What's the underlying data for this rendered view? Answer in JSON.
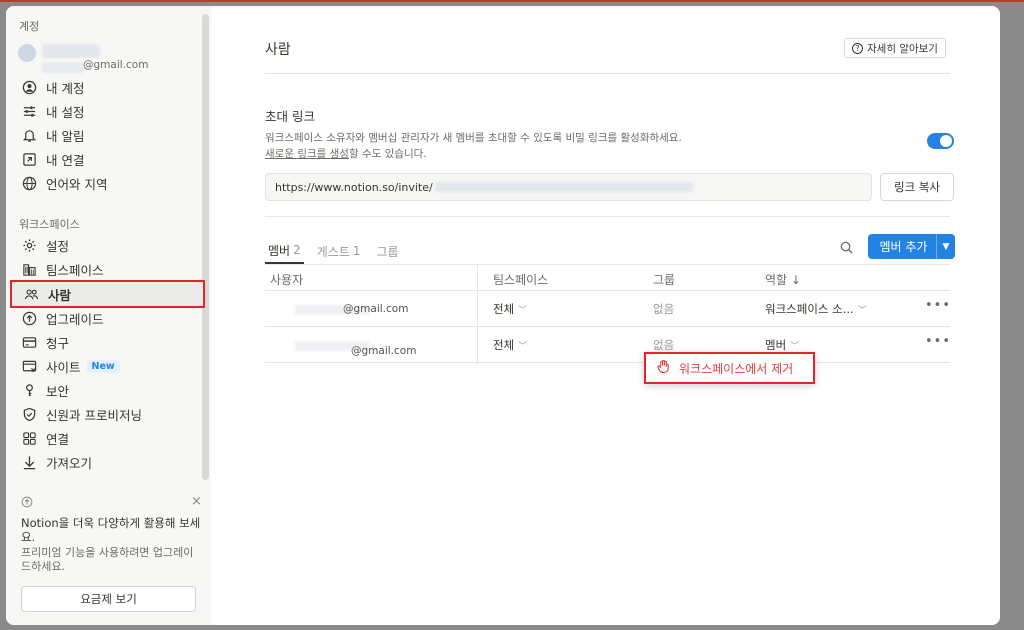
{
  "sidebar": {
    "account_heading": "계정",
    "user_email_suffix": "@gmail.com",
    "account_items": [
      {
        "label": "내 계정",
        "icon": "user-circle-icon"
      },
      {
        "label": "내 설정",
        "icon": "sliders-icon"
      },
      {
        "label": "내 알림",
        "icon": "bell-icon"
      },
      {
        "label": "내 연결",
        "icon": "external-link-icon"
      },
      {
        "label": "언어와 지역",
        "icon": "globe-icon"
      }
    ],
    "workspace_heading": "워크스페이스",
    "workspace_items": [
      {
        "label": "설정",
        "icon": "gear-icon"
      },
      {
        "label": "팀스페이스",
        "icon": "buildings-icon"
      },
      {
        "label": "사람",
        "icon": "people-icon",
        "active": true
      },
      {
        "label": "업그레이드",
        "icon": "arrow-up-circle-icon"
      },
      {
        "label": "청구",
        "icon": "credit-card-icon"
      },
      {
        "label": "사이트",
        "icon": "site-icon",
        "badge": "New"
      },
      {
        "label": "보안",
        "icon": "key-icon"
      },
      {
        "label": "신원과 프로비저닝",
        "icon": "shield-icon"
      },
      {
        "label": "연결",
        "icon": "grid-icon"
      },
      {
        "label": "가져오기",
        "icon": "download-arrow-icon"
      }
    ],
    "upsell": {
      "title": "Notion을 더욱 다양하게 활용해 보세요.",
      "description": "프리미엄 기능을 사용하려면 업그레이드하세요.",
      "button": "요금제 보기",
      "close": "×"
    }
  },
  "main": {
    "title": "사람",
    "learn_more": "자세히 알아보기",
    "invite": {
      "title": "초대 링크",
      "description_line1": "워크스페이스 소유자와 멤버십 관리자가 새 멤버를 초대할 수 있도록 비밀 링크를 활성화하세요.",
      "description_link": "새로운 링크를 생성",
      "description_line2_rest": "할 수도 있습니다.",
      "link_prefix": "https://www.notion.so/invite/",
      "copy_button": "링크 복사",
      "enabled": true
    },
    "tabs": [
      {
        "label": "멤버",
        "count": "2",
        "active": true
      },
      {
        "label": "게스트",
        "count": "1",
        "active": false
      },
      {
        "label": "그룹",
        "count": "",
        "active": false
      }
    ],
    "add_member_button": "멤버 추가",
    "table": {
      "headers": {
        "user": "사용자",
        "teamspace": "팀스페이스",
        "group": "그룹",
        "role": "역할 ↓"
      },
      "rows": [
        {
          "email": "@gmail.com",
          "teamspace": "전체",
          "group": "없음",
          "role": "워크스페이스 소..."
        },
        {
          "email": "@gmail.com",
          "teamspace": "전체",
          "group": "없음",
          "role": "멤버"
        }
      ]
    },
    "context_menu": {
      "remove_label": "워크스페이스에서 제거"
    }
  }
}
